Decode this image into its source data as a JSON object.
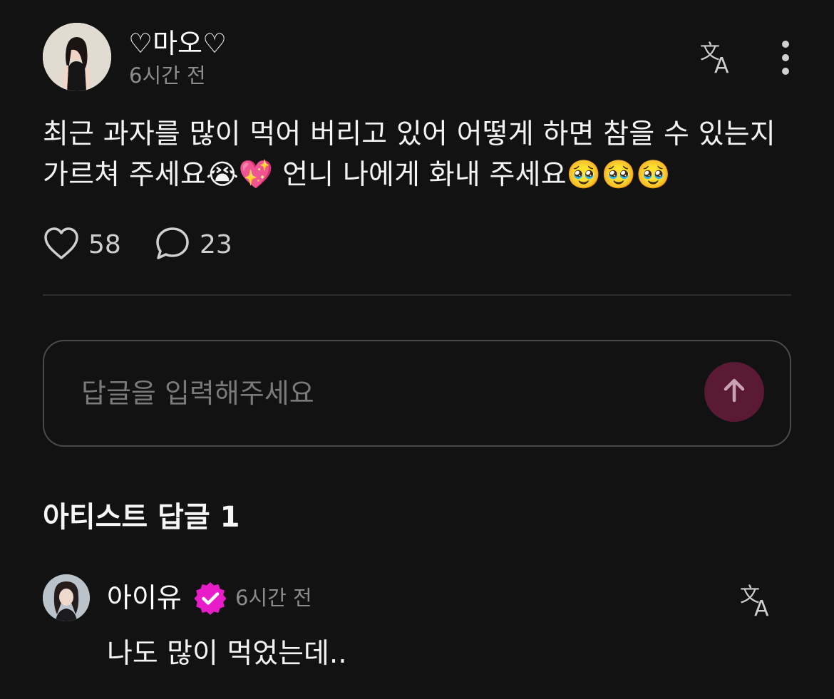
{
  "post": {
    "author_name": "♡마오♡",
    "time": "6시간 전",
    "body": "최근 과자를 많이 먹어 버리고 있어 어떻게 하면 참을 수 있는지 가르쳐 주세요😭💖 언니 나에게 화내 주세요🥹🥹🥹",
    "like_count": "58",
    "comment_count": "23"
  },
  "icons": {
    "translate": "translate-icon",
    "more": "more-vertical-icon",
    "like": "heart-outline-icon",
    "comment": "speech-bubble-icon",
    "send": "arrow-up-icon",
    "verified": "verified-badge-icon"
  },
  "reply_box": {
    "placeholder": "답글을 입력해주세요"
  },
  "artist_replies": {
    "title": "아티스트 답글 1",
    "items": [
      {
        "name": "아이유",
        "time": "6시간 전",
        "text": "나도 많이 먹었는데.."
      }
    ]
  },
  "colors": {
    "background": "#121212",
    "send_button": "#5a1a34",
    "verified_badge": "#e81cc8",
    "muted_text": "#8c8c8c"
  }
}
